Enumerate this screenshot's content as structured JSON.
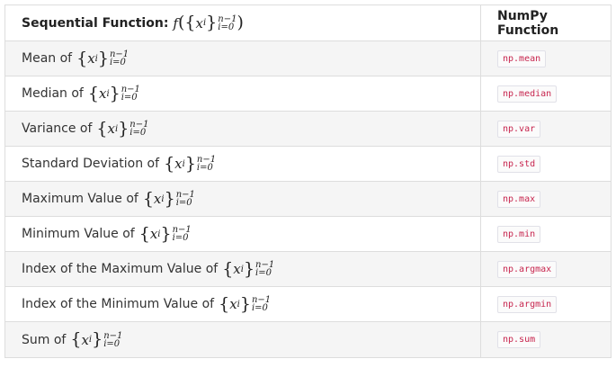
{
  "table": {
    "header": {
      "function_label": "Sequential Function:",
      "numpy_label": "NumPy Function"
    },
    "sequence_notation": {
      "set_var": "x",
      "subscript_index": "i",
      "upper": "n−1",
      "lower": "i=0",
      "func": "f"
    },
    "rows": [
      {
        "label": "Mean of",
        "numpy": "np.mean"
      },
      {
        "label": "Median of",
        "numpy": "np.median"
      },
      {
        "label": "Variance of",
        "numpy": "np.var"
      },
      {
        "label": "Standard Deviation of",
        "numpy": "np.std"
      },
      {
        "label": "Maximum Value of",
        "numpy": "np.max"
      },
      {
        "label": "Minimum Value of",
        "numpy": "np.min"
      },
      {
        "label": "Index of the Maximum Value of",
        "numpy": "np.argmax"
      },
      {
        "label": "Index of the Minimum Value of",
        "numpy": "np.argmin"
      },
      {
        "label": "Sum of",
        "numpy": "np.sum"
      }
    ]
  }
}
